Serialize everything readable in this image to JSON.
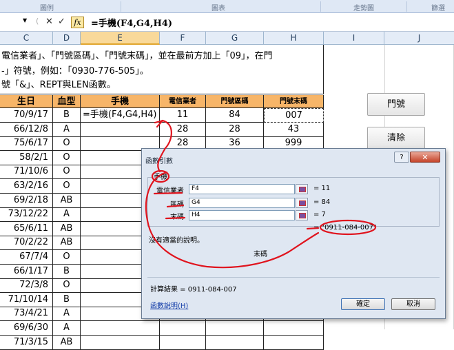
{
  "ribbon": {
    "groups": [
      "圖例",
      "圖表",
      "走勢圖",
      "篩選"
    ]
  },
  "formula_bar": {
    "fx": "fx",
    "cancel": "✕",
    "enter": "✓",
    "formula": "=手機(F4,G4,H4)"
  },
  "columns": [
    "C",
    "D",
    "E",
    "F",
    "G",
    "H",
    "I",
    "J"
  ],
  "instructions": [
    "電信業者」、「門號區碼」、「門號末碼」，並在最前方加上「09」，在門",
    "-」符號，例如：「0930-776-505」。",
    "號「&」、REPT與LEN函數。"
  ],
  "table": {
    "headers": [
      "生日",
      "血型",
      "手機",
      "電信業者",
      "門號區碼",
      "門號末碼"
    ],
    "rows": [
      [
        "70/9/17",
        "B",
        "=手機(F4,G4,H4)",
        "11",
        "84",
        "007"
      ],
      [
        "66/12/8",
        "A",
        "",
        "28",
        "28",
        "43"
      ],
      [
        "75/6/17",
        "O",
        "",
        "28",
        "36",
        "999"
      ],
      [
        "58/2/1",
        "O",
        "",
        "",
        "",
        ""
      ],
      [
        "71/10/6",
        "O",
        "",
        "",
        "",
        ""
      ],
      [
        "63/2/16",
        "O",
        "",
        "",
        "",
        ""
      ],
      [
        "69/2/18",
        "AB",
        "",
        "",
        "",
        ""
      ],
      [
        "73/12/22",
        "A",
        "",
        "",
        "",
        ""
      ],
      [
        "65/6/11",
        "AB",
        "",
        "",
        "",
        ""
      ],
      [
        "70/2/22",
        "AB",
        "",
        "",
        "",
        ""
      ],
      [
        "67/7/4",
        "O",
        "",
        "",
        "",
        ""
      ],
      [
        "66/1/17",
        "B",
        "",
        "",
        "",
        ""
      ],
      [
        "72/3/8",
        "O",
        "",
        "",
        "",
        ""
      ],
      [
        "71/10/14",
        "B",
        "",
        "",
        "",
        ""
      ],
      [
        "73/4/21",
        "A",
        "",
        "",
        "",
        ""
      ],
      [
        "69/6/30",
        "A",
        "",
        "",
        "",
        ""
      ],
      [
        "71/3/15",
        "AB",
        "",
        "",
        "",
        ""
      ]
    ]
  },
  "buttons": {
    "phone": "門號",
    "clear": "清除"
  },
  "dialog": {
    "title": "函數引數",
    "function_name": "手機",
    "help_glyph": "?",
    "close_glyph": "✕",
    "args": [
      {
        "label": "電信業者",
        "value": "F4",
        "result": "= 11"
      },
      {
        "label": "區碼",
        "value": "G4",
        "result": "= 84"
      },
      {
        "label": "末碼",
        "value": "H4",
        "result": "= 7"
      }
    ],
    "result": "= \"0911-084-007\"",
    "description": "沒有適當的說明。",
    "arg_description": "末碼",
    "calc_result": "計算結果 =   0911-084-007",
    "help_link": "函數說明(H)",
    "ok": "確定",
    "cancel": "取消"
  },
  "colors": {
    "header_fill": "#f7b568",
    "selected_col": "#f9d99a",
    "annotation": "#e0141e"
  }
}
